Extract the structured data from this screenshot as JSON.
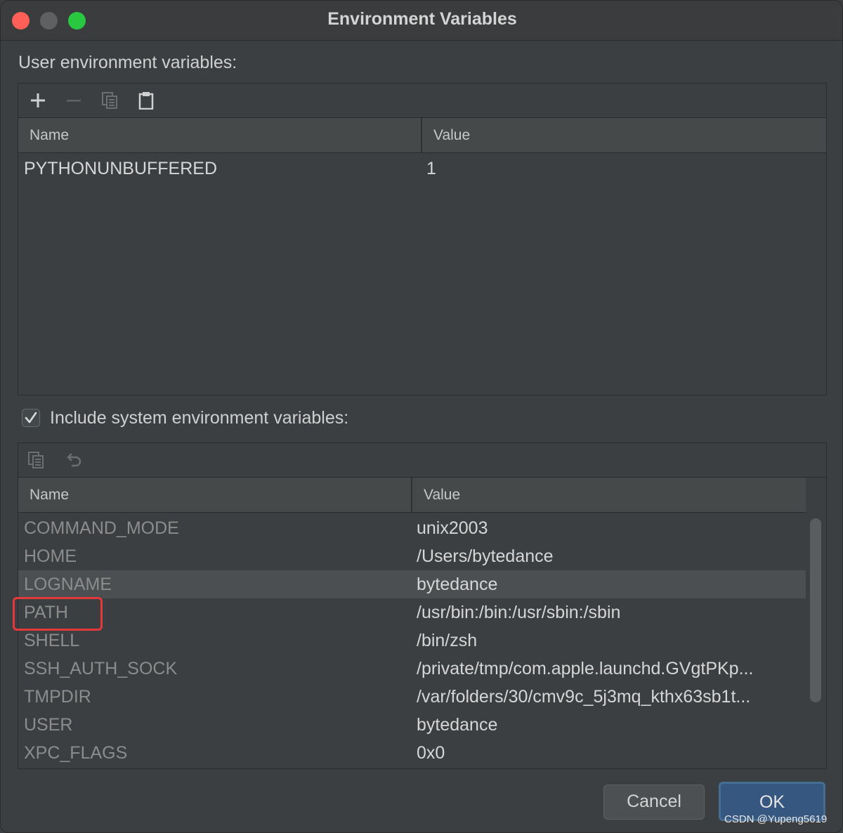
{
  "window": {
    "title": "Environment Variables"
  },
  "user_section": {
    "label": "User environment variables:",
    "toolbar_icons": [
      "add-icon",
      "remove-icon",
      "copy-icon",
      "paste-icon"
    ],
    "columns": [
      "Name",
      "Value"
    ],
    "rows": [
      {
        "name": "PYTHONUNBUFFERED",
        "value": "1"
      }
    ]
  },
  "system_section": {
    "checkbox_label": "Include system environment variables:",
    "checkbox_checked": true,
    "toolbar_icons": [
      "copy-icon",
      "undo-icon"
    ],
    "columns": [
      "Name",
      "Value"
    ],
    "selected_row": "LOGNAME",
    "highlighted_row": "PATH",
    "highlight_color": "#e5383b",
    "rows": [
      {
        "name": "COMMAND_MODE",
        "value": "unix2003"
      },
      {
        "name": "HOME",
        "value": "/Users/bytedance"
      },
      {
        "name": "LOGNAME",
        "value": "bytedance"
      },
      {
        "name": "PATH",
        "value": "/usr/bin:/bin:/usr/sbin:/sbin"
      },
      {
        "name": "SHELL",
        "value": "/bin/zsh"
      },
      {
        "name": "SSH_AUTH_SOCK",
        "value": "/private/tmp/com.apple.launchd.GVgtPKp..."
      },
      {
        "name": "TMPDIR",
        "value": "/var/folders/30/cmv9c_5j3mq_kthx63sb1t..."
      },
      {
        "name": "USER",
        "value": "bytedance"
      },
      {
        "name": "XPC_FLAGS",
        "value": "0x0"
      }
    ]
  },
  "buttons": {
    "cancel": "Cancel",
    "ok": "OK"
  },
  "watermark": "CSDN @Yupeng5619",
  "colors": {
    "background": "#3c3f41",
    "header": "#45494a",
    "selected_row": "#4b4f51",
    "ok_button": "#365880",
    "close": "#fe5f57",
    "maximize": "#28c840"
  }
}
